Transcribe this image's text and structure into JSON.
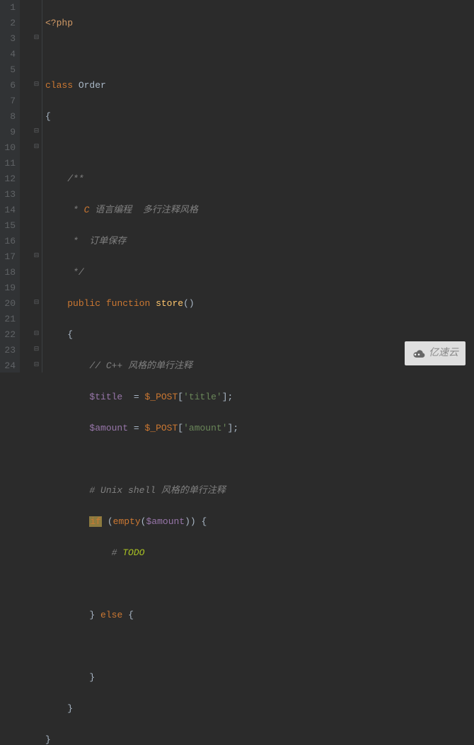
{
  "lines": {
    "1": "1",
    "2": "2",
    "3": "3",
    "4": "4",
    "5": "5",
    "6": "6",
    "7": "7",
    "8": "8",
    "9": "9",
    "10": "10",
    "11": "11",
    "12": "12",
    "13": "13",
    "14": "14",
    "15": "15",
    "16": "16",
    "17": "17",
    "18": "18",
    "19": "19",
    "20": "20",
    "21": "21",
    "22": "22",
    "23": "23",
    "24": "24"
  },
  "code": {
    "php_open": "<?php",
    "class_kw": "class",
    "class_name": "Order",
    "brace_open": "{",
    "brace_close": "}",
    "doc_open": "/**",
    "doc_star": " * ",
    "doc_c": "C",
    "doc_text1": " 语言编程  多行注释风格",
    "doc_text2": " 订单保存",
    "doc_close": " */",
    "public_kw": "public",
    "function_kw": "function",
    "func_name": "store",
    "parens": "()",
    "comment_cpp_prefix": "// ",
    "comment_cpp_text": "C++ 风格的单行注释",
    "var_title": "$title",
    "var_amount": "$amount",
    "eq": "=",
    "post": "$_POST",
    "bracket_open": "[",
    "bracket_close": "]",
    "str_title": "'title'",
    "str_amount": "'amount'",
    "semi": ";",
    "comment_shell_prefix": "# ",
    "comment_shell_text": "Unix shell 风格的单行注释",
    "if_kw": "if",
    "empty_kw": "empty",
    "paren_open": "(",
    "paren_close": ")",
    "todo_prefix": "# ",
    "todo_text": "TODO",
    "else_kw": "else"
  },
  "watermark": {
    "text": "亿速云"
  }
}
